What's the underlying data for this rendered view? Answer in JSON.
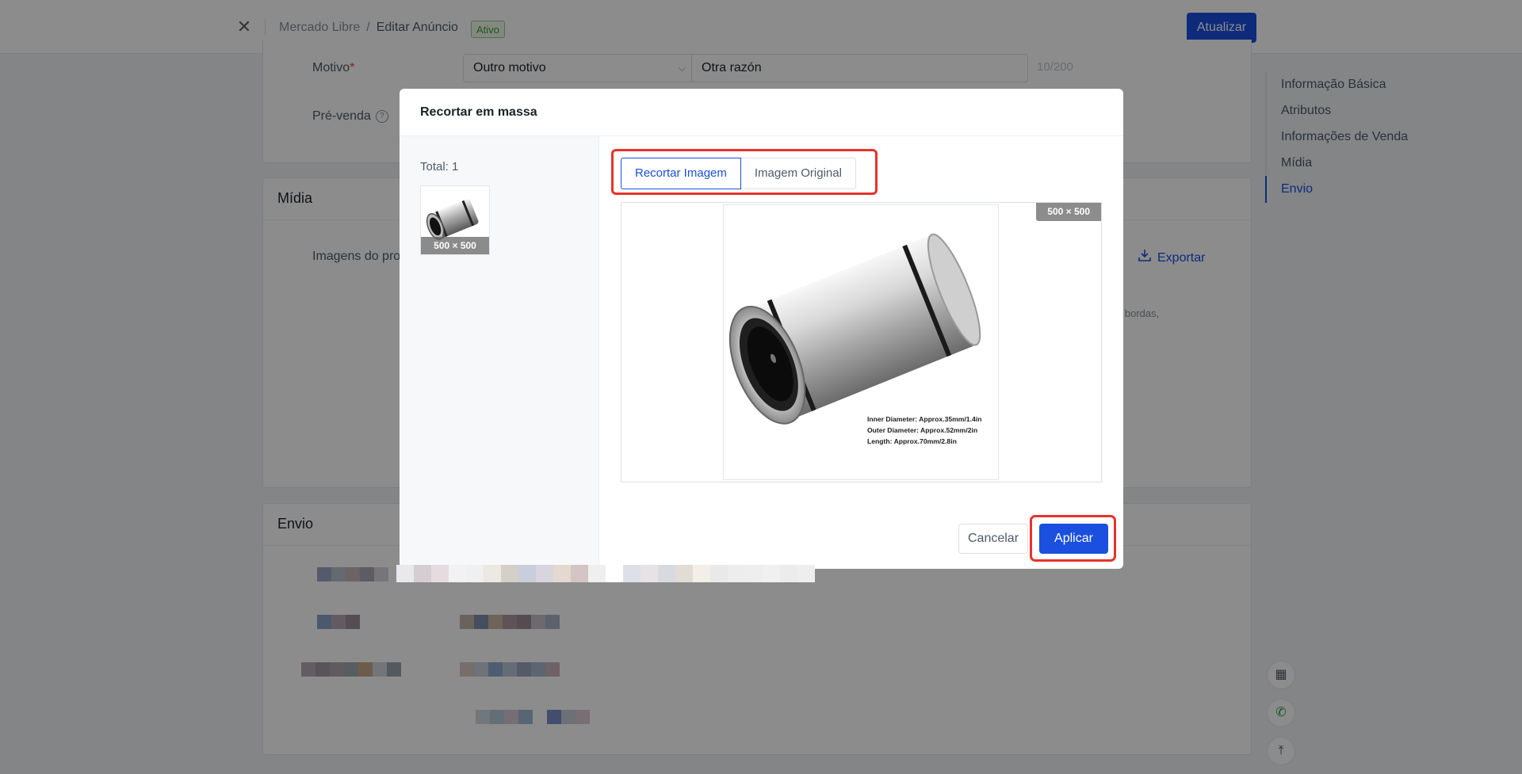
{
  "header": {
    "breadcrumb_root": "Mercado Libre",
    "breadcrumb_sep": "/",
    "breadcrumb_current": "Editar Anúncio",
    "status_badge": "Ativo",
    "update_button": "Atualizar"
  },
  "form": {
    "reason_label": "Motivo",
    "reason_required_mark": "*",
    "reason_select_value": "Outro motivo",
    "reason_text_value": "Otra razón",
    "reason_counter": "10/200",
    "presale_label": "Pré-venda",
    "presale_help": "?"
  },
  "media_section": {
    "title": "Mídia",
    "images_label": "Imagens do proc",
    "export_label": "Exportar",
    "hint_fragment": "e bordas,"
  },
  "shipping_section": {
    "title": "Envio"
  },
  "anchor_nav": {
    "items": [
      "Informação Básica",
      "Atributos",
      "Informações de Venda",
      "Mídia",
      "Envio"
    ],
    "active": "Envio"
  },
  "dialog": {
    "title": "Recortar em massa",
    "total_label": "Total: 1",
    "thumb_size": "500 × 500",
    "tabs": [
      "Recortar Imagem",
      "Imagem Original"
    ],
    "active_tab": "Recortar Imagem",
    "preview_size": "500 × 500",
    "product_spec_lines": [
      "Inner Diameter: Approx.35mm/1.4in",
      "Outer Diameter: Approx.52mm/2in",
      "Length: Approx.70mm/2.8in"
    ],
    "cancel_button": "Cancelar",
    "apply_button": "Aplicar"
  },
  "floating_tools": [
    "calculator-icon",
    "whatsapp-icon",
    "back-to-top-icon"
  ],
  "colors": {
    "primary": "#1a4fe0",
    "highlight": "#e8322b",
    "active_badge_text": "#3a9d33",
    "overlay": "rgba(0,0,0,0.45)"
  }
}
